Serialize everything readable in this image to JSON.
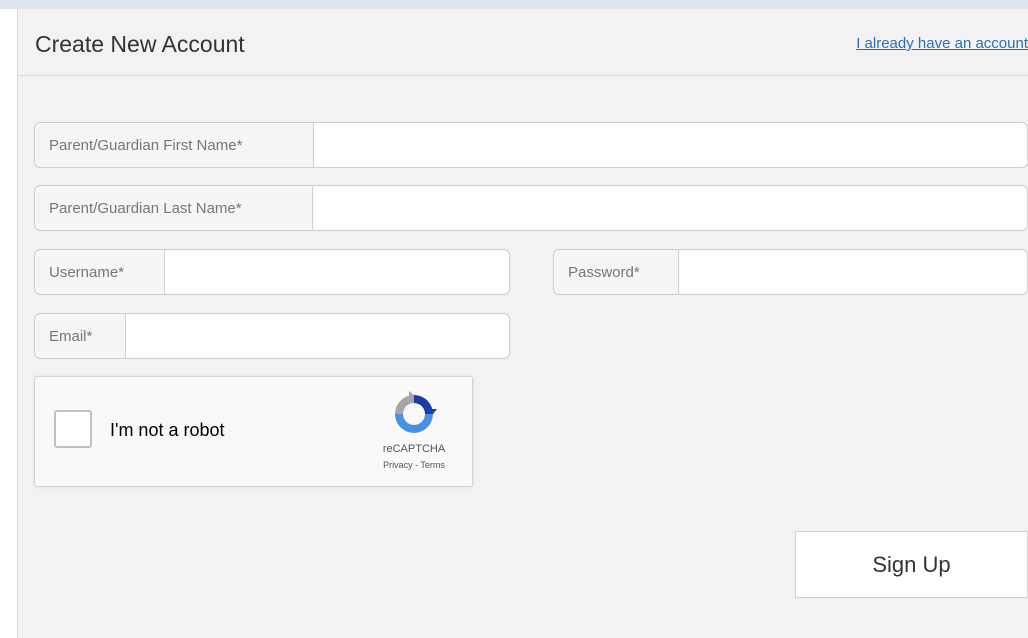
{
  "header": {
    "title": "Create New Account",
    "login_link": "I already have an account"
  },
  "form": {
    "first_name": {
      "label": "Parent/Guardian First Name*",
      "value": ""
    },
    "last_name": {
      "label": "Parent/Guardian Last Name*",
      "value": ""
    },
    "username": {
      "label": "Username*",
      "value": ""
    },
    "password": {
      "label": "Password*",
      "value": ""
    },
    "email": {
      "label": "Email*",
      "value": ""
    }
  },
  "recaptcha": {
    "label": "I'm not a robot",
    "brand": "reCAPTCHA",
    "privacy": "Privacy",
    "separator": " - ",
    "terms": "Terms",
    "checked": false,
    "logo_icon": "recaptcha-logo-icon"
  },
  "actions": {
    "signup_label": "Sign Up"
  },
  "colors": {
    "link": "#2a6fb6",
    "panel_bg": "#f2f2f2",
    "border": "#cfcfcf"
  }
}
